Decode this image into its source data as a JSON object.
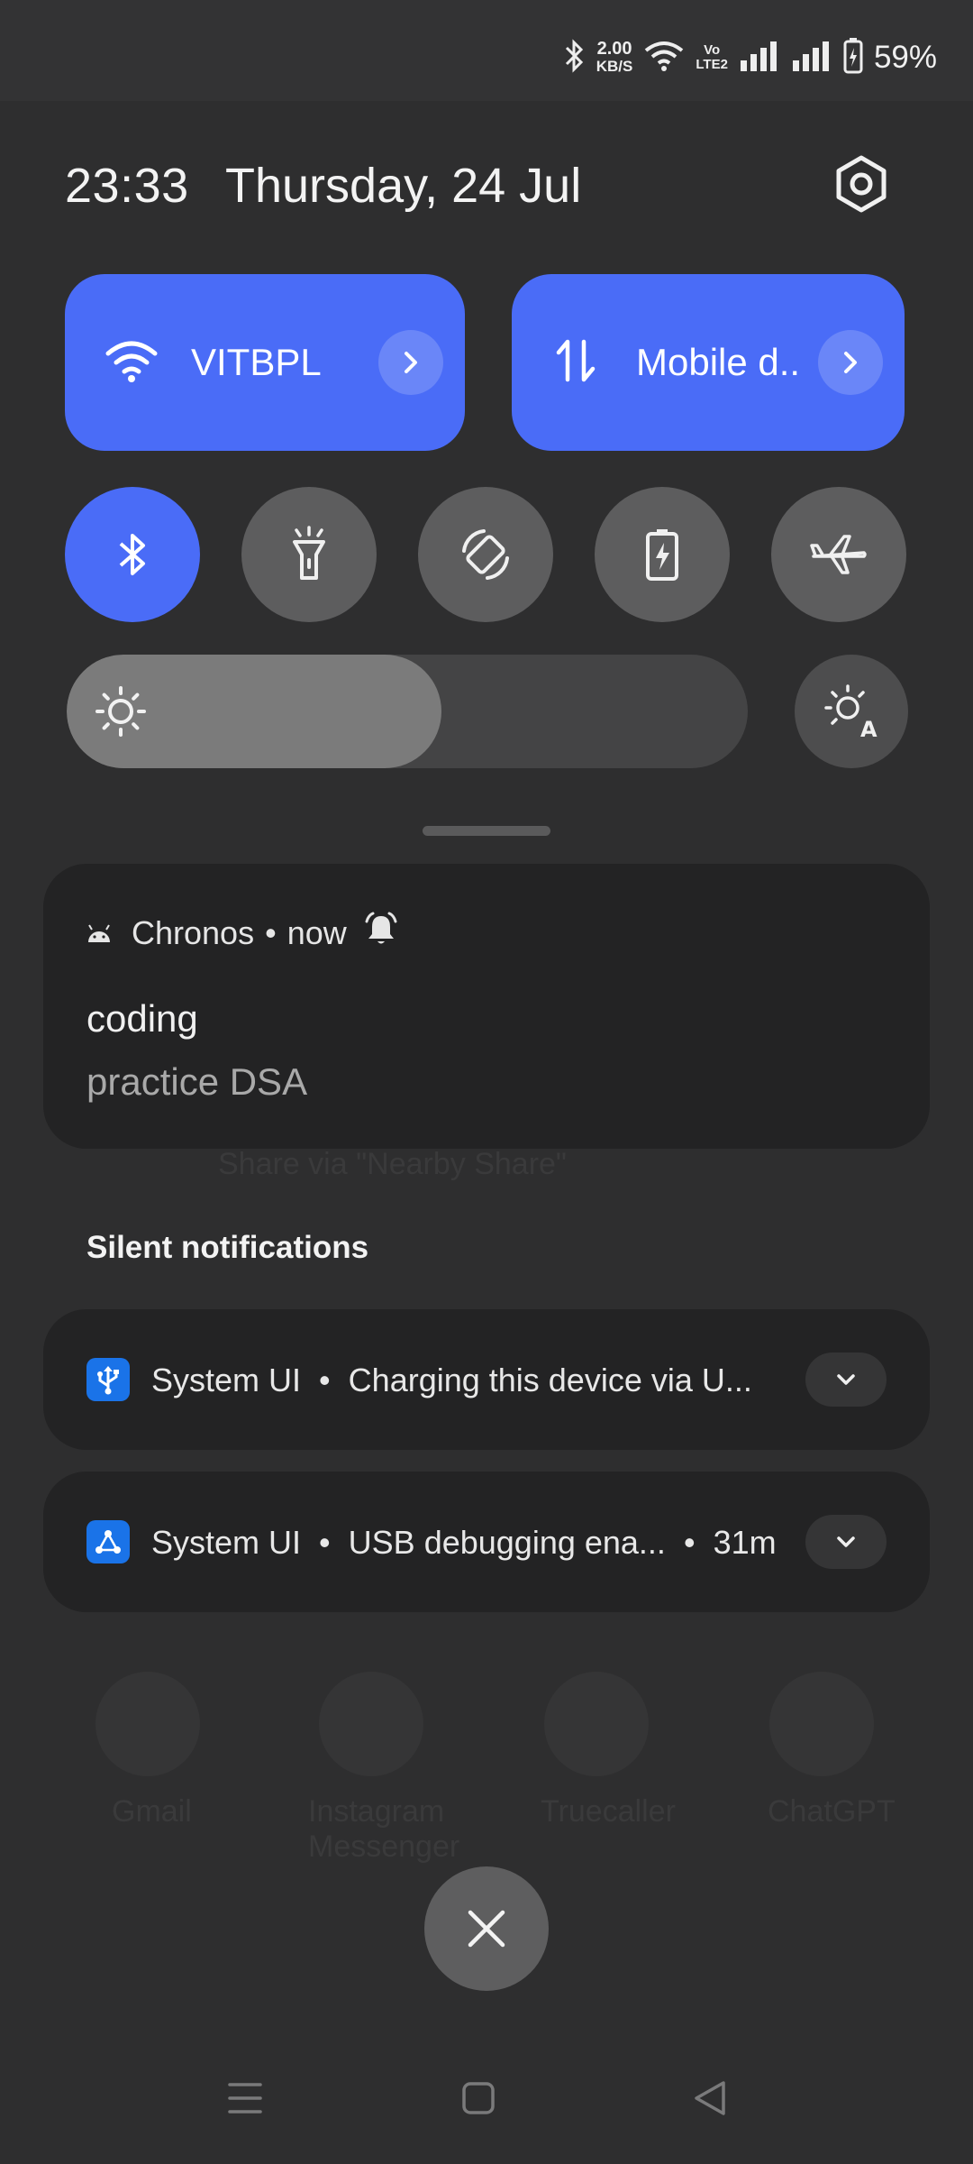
{
  "status_bar": {
    "net_speed_value": "2.00",
    "net_speed_unit": "KB/S",
    "volte_top": "Vo",
    "volte_bottom": "LTE2",
    "battery_percent": "59%"
  },
  "header": {
    "time": "23:33",
    "date": "Thursday, 24 Jul"
  },
  "tiles": {
    "wifi_label": "VITBPL",
    "mobile_label": "Mobile d.."
  },
  "toggles": [
    {
      "name": "bluetooth",
      "state": "on"
    },
    {
      "name": "flashlight",
      "state": "off"
    },
    {
      "name": "auto-rotate",
      "state": "off"
    },
    {
      "name": "battery-saver",
      "state": "off"
    },
    {
      "name": "airplane-mode",
      "state": "off"
    }
  ],
  "brightness": {
    "level": 0.55
  },
  "notification": {
    "app": "Chronos",
    "time": "now",
    "title": "coding",
    "text": "practice DSA"
  },
  "silent": {
    "label": "Silent notifications",
    "items": [
      {
        "app": "System UI",
        "text": "Charging this device via U..."
      },
      {
        "app": "System UI",
        "text": "USB debugging ena...",
        "time": "31m"
      }
    ]
  },
  "background": {
    "share_text": "Share via \"Nearby Share\"",
    "apps": [
      "Gmail",
      "Instagram Messenger",
      "Truecaller",
      "ChatGPT"
    ]
  },
  "colors": {
    "accent": "#4a6cf7",
    "panel": "#2e2e2f",
    "card": "#232324",
    "app_badge": "#1a73e8"
  }
}
